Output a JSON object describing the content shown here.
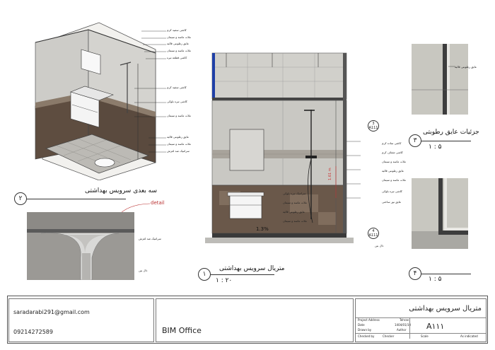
{
  "view_isometric": {
    "number": "۲",
    "title": "سه بعدی سرویس بهداشتی",
    "callouts": [
      "کاشی سفید کرم",
      "ملات ماسه و سیمان",
      "عایق رطوبتی قالیه",
      "ملات ماسه و سیمان",
      "کاشی قطعه تیره",
      "کاشی سفید کرم",
      "کاشی تیره بلوکی",
      "ملات ماسه و سیمان",
      "عایق رطوبتی قالیه",
      "ملات ماسه و سیمان",
      "سرامیک ضد لغزش"
    ]
  },
  "detail": {
    "tag": "detail",
    "callouts": [
      "سرامیک ضد لغزش",
      "دال بتن"
    ]
  },
  "view_elevation": {
    "number": "۱",
    "title": "متریال سرویس بهداشتی",
    "scale": "۱ : ۲۰",
    "slope": "1.3%",
    "height_tag": "1.61 m",
    "section_3": {
      "num": "3",
      "sheet": "A111"
    },
    "section_4": {
      "num": "4",
      "sheet": "A111"
    },
    "inner_callouts": [
      "سرامیک تیره بلوکی",
      "ملات ماسه و سیمان",
      "عایق رطوبتی قالیه",
      "ملات ماسه و سیمان"
    ],
    "right_callouts": [
      "کاشی ساده کرم",
      "کاشی شفاف کرم",
      "ملات ماسه و سیمان",
      "عایق رطوبتی قالیه",
      "ملات ماسه و سیمان",
      "کاشی تیره بلوکی",
      "عایق نور ساختی"
    ],
    "floor_callout": "دال بتن"
  },
  "view_detail3": {
    "number": "۳",
    "title": "جزئیات عایق رطوبتی",
    "scale": "۱ : ۵",
    "callout": "عایق رطوبتی قالیه"
  },
  "view_detail4": {
    "number": "۴",
    "scale": "۱ : ۵"
  },
  "title_block": {
    "email": "saradarabi291@gmail.com",
    "phone": "09214272589",
    "company": "BIM Office",
    "sheet_title": "متریال سرویس بهداشتی",
    "project_address_label": "Project Address",
    "project_address": "Tehran",
    "date_label": "Date",
    "date": "1404/01/10",
    "drawn_by_label": "Drawn by",
    "drawn_by": "Author",
    "checked_by_label": "Checked by",
    "checked_by": "Checker",
    "scale_label": "Scale",
    "scale": "As indicated",
    "sheet_number": "A۱۱۱"
  }
}
